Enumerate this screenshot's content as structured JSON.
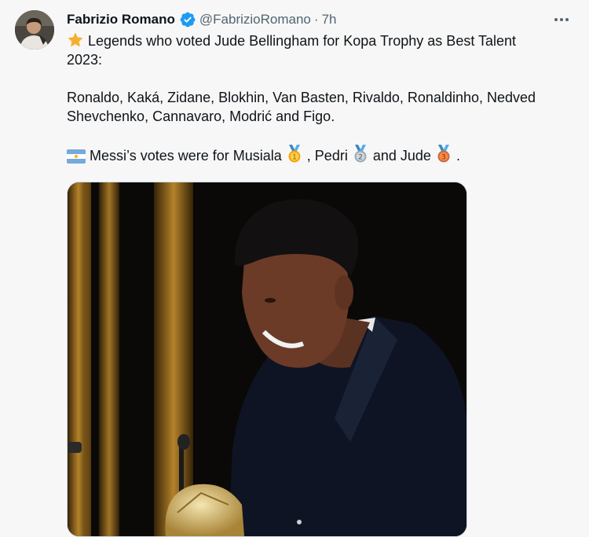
{
  "author": {
    "name": "Fabrizio Romano",
    "handle": "@FabrizioRomano",
    "separator": "·",
    "time": "7h",
    "verified": true,
    "verified_color": "#1d9bf0"
  },
  "post": {
    "line1": "Legends who voted Jude Bellingham for Kopa Trophy as Best Talent",
    "line2": "2023:",
    "line3": "Ronaldo, Kaká, Zidane, Blokhin, Van Basten, Rivaldo, Ronaldinho, Nedved",
    "line4": "Shevchenko, Cannavaro, Modrić and Figo.",
    "messi_text_1": "Messi’s votes were for Musiala",
    "messi_text_2": ", Pedri",
    "messi_text_3": "and Jude",
    "messi_text_4": "."
  },
  "icons": {
    "star": "star-emoji",
    "flag": "argentina-flag-emoji",
    "medal1": "first-place-medal-emoji",
    "medal2": "second-place-medal-emoji",
    "medal3": "third-place-medal-emoji",
    "more": "more-options-icon",
    "verified": "verified-badge-icon"
  },
  "colors": {
    "text": "#0f1419",
    "secondary": "#536471",
    "background": "#f7f7f7"
  }
}
